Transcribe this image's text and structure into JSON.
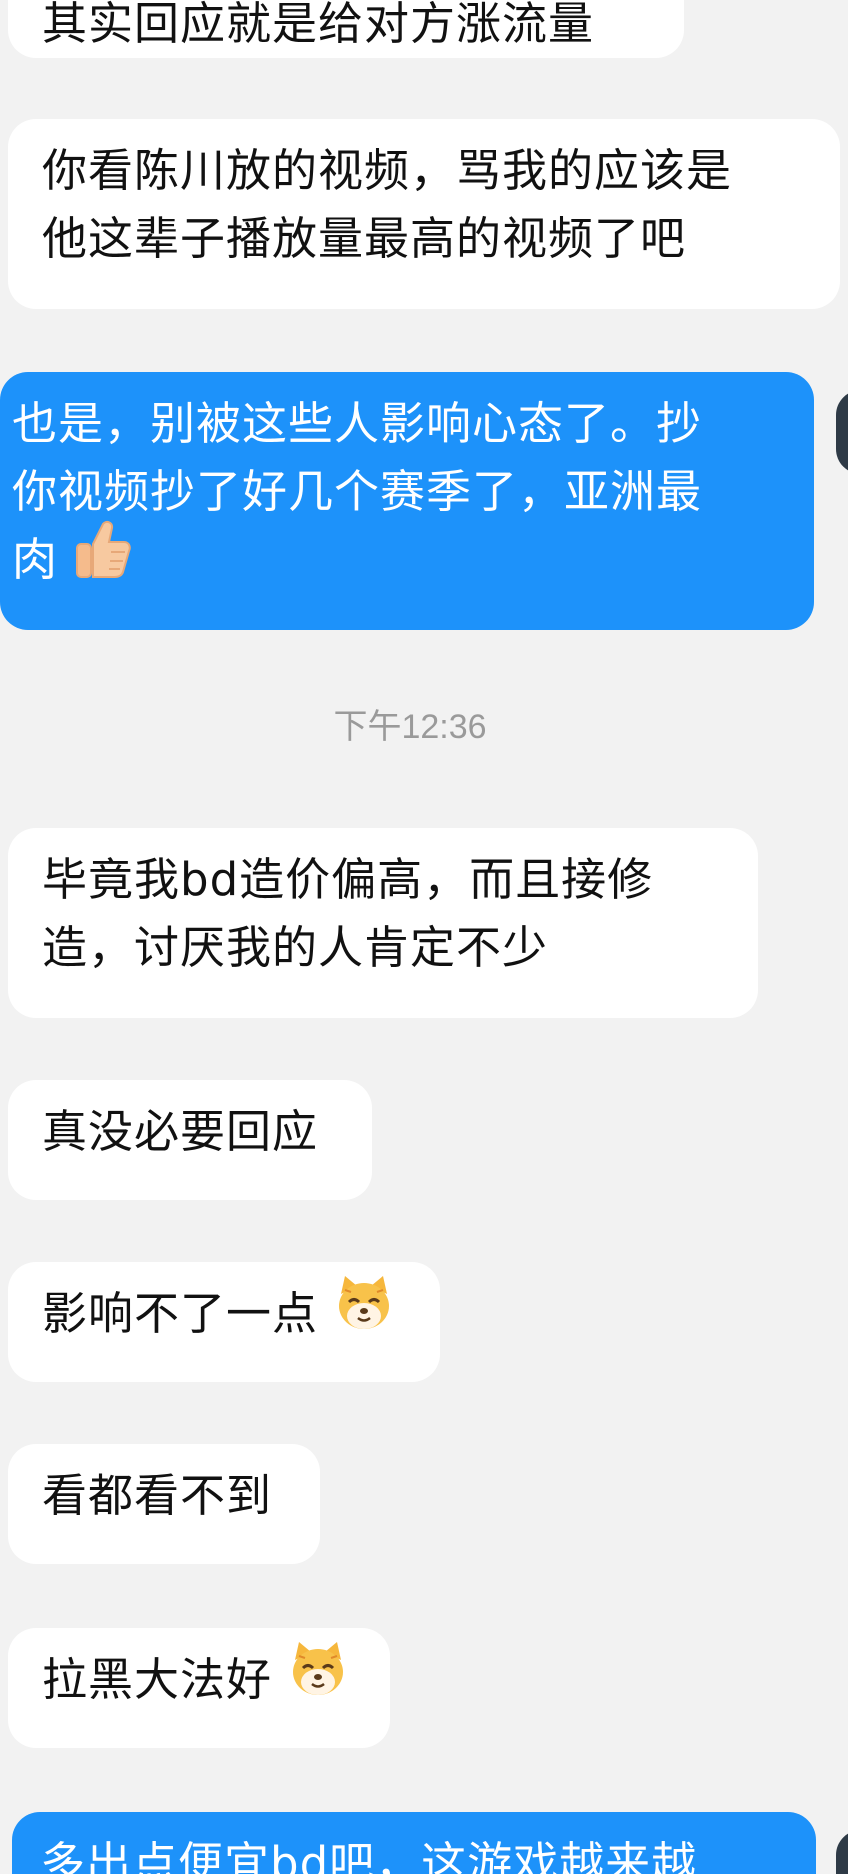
{
  "messages": [
    {
      "side": "in",
      "lines": [
        "其实回应就是给对方涨流量"
      ]
    },
    {
      "side": "in",
      "lines": [
        "你看陈川放的视频，骂我的应该是",
        "他这辈子播放量最高的视频了吧"
      ]
    },
    {
      "side": "out",
      "lines": [
        "也是，别被这些人影响心态了。抄",
        "你视频抄了好几个赛季了，亚洲最",
        "肉"
      ],
      "emoji": "thumbs-up-icon"
    },
    {
      "side": "in",
      "lines": [
        "毕竟我bd造价偏高，而且接修",
        "造，讨厌我的人肯定不少"
      ]
    },
    {
      "side": "in",
      "lines": [
        "真没必要回应"
      ]
    },
    {
      "side": "in",
      "lines": [
        "影响不了一点"
      ],
      "emoji": "smug-dog-face-icon"
    },
    {
      "side": "in",
      "lines": [
        "看都看不到"
      ]
    },
    {
      "side": "in",
      "lines": [
        "拉黑大法好"
      ],
      "emoji": "smug-dog-face-icon"
    },
    {
      "side": "out",
      "lines": [
        "多出点便宜bd吧，这游戏越来越"
      ]
    }
  ],
  "timestamp": "下午12:36",
  "colors": {
    "background": "#f2f2f2",
    "incoming_bubble": "#ffffff",
    "outgoing_bubble": "#1d92fa",
    "timestamp_text": "#9a9a9a"
  }
}
